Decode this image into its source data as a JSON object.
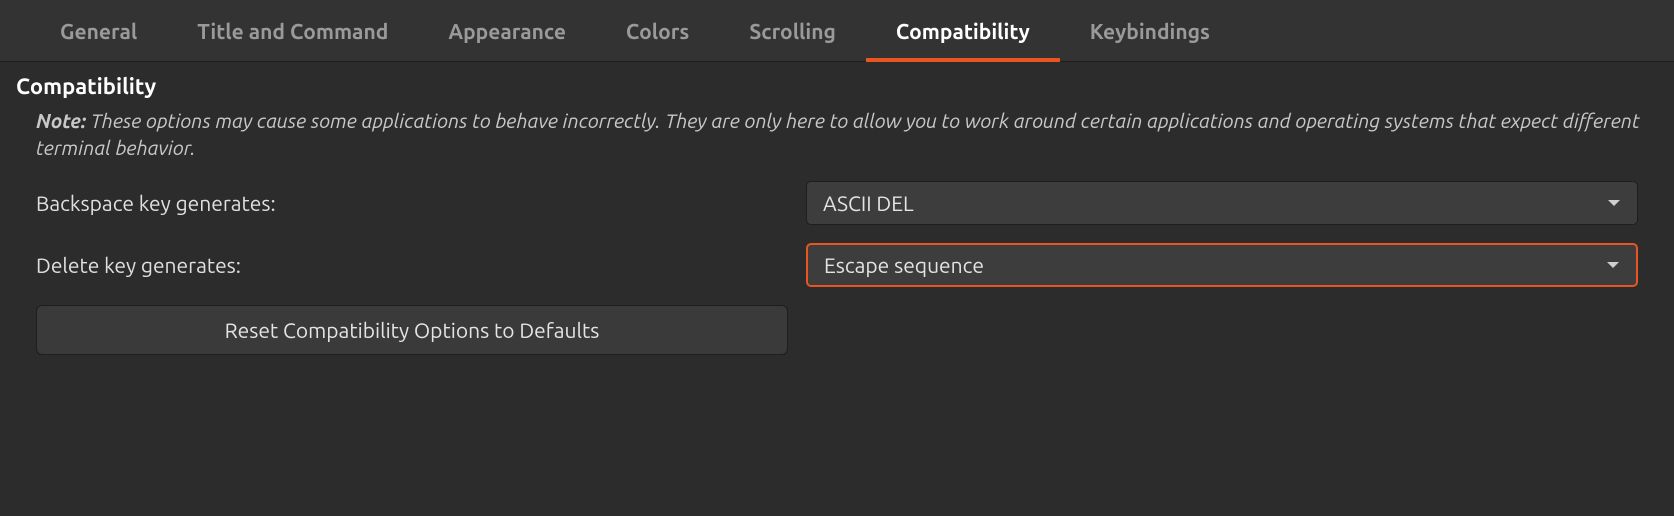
{
  "tabs": {
    "general": "General",
    "title_and_command": "Title and Command",
    "appearance": "Appearance",
    "colors": "Colors",
    "scrolling": "Scrolling",
    "compatibility": "Compatibility",
    "keybindings": "Keybindings"
  },
  "section": {
    "title": "Compatibility",
    "note_label": "Note:",
    "note_text": "These options may cause some applications to behave incorrectly.  They are only here to allow you to work around certain applications and operating systems that expect different terminal behavior."
  },
  "form": {
    "backspace_label": "Backspace key generates:",
    "backspace_value": "ASCII DEL",
    "delete_label": "Delete key generates:",
    "delete_value": "Escape sequence",
    "reset_button": "Reset Compatibility Options to Defaults"
  },
  "colors": {
    "accent": "#e95420"
  }
}
